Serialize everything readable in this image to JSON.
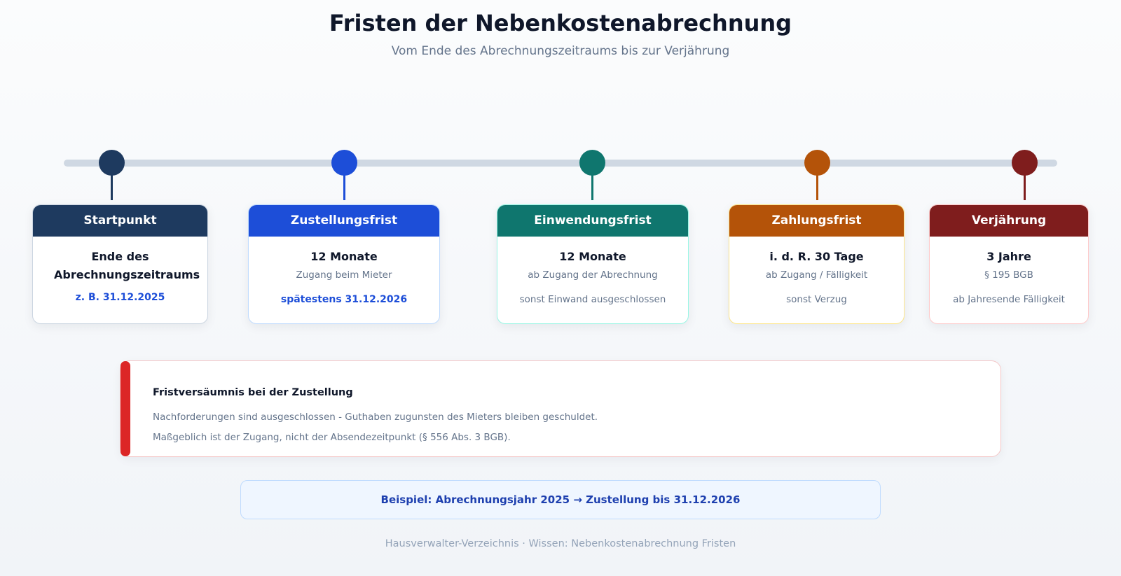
{
  "header": {
    "title": "Fristen der Nebenkostenabrechnung",
    "subtitle": "Vom Ende des Abrechnungszeitraums bis zur Verjährung"
  },
  "milestones": [
    {
      "label": "Startpunkt",
      "main": "Ende des Abrechnungszeitraums",
      "sub": "",
      "note": "z. B. 31.12.2025",
      "color": "#1e3a5f"
    },
    {
      "label": "Zustellungsfrist",
      "main": "12 Monate",
      "sub": "Zugang beim Mieter",
      "note": "spätestens 31.12.2026",
      "color": "#1d4ed8"
    },
    {
      "label": "Einwendungsfrist",
      "main": "12 Monate",
      "sub": "ab Zugang der Abrechnung",
      "note": "sonst Einwand ausgeschlossen",
      "color": "#0f766e"
    },
    {
      "label": "Zahlungsfrist",
      "main": "i. d. R. 30 Tage",
      "sub": "ab Zugang / Fälligkeit",
      "note": "sonst Verzug",
      "color": "#b45309"
    },
    {
      "label": "Verjährung",
      "main": "3 Jahre",
      "sub": "§ 195 BGB",
      "note": "ab Jahresende Fälligkeit",
      "color": "#7f1d1d"
    }
  ],
  "warning": {
    "title": "Fristversäumnis bei der Zustellung",
    "line1": "Nachforderungen sind ausgeschlossen - Guthaben zugunsten des Mieters bleiben geschuldet.",
    "line2": "Maßgeblich ist der Zugang, nicht der Absendezeitpunkt (§ 556 Abs. 3 BGB).",
    "accent": "#dc2626"
  },
  "example": {
    "text": "Beispiel: Abrechnungsjahr 2025 → Zustellung bis 31.12.2026"
  },
  "footer": {
    "text": "Hausverwalter-Verzeichnis · Wissen: Nebenkostenabrechnung Fristen"
  }
}
